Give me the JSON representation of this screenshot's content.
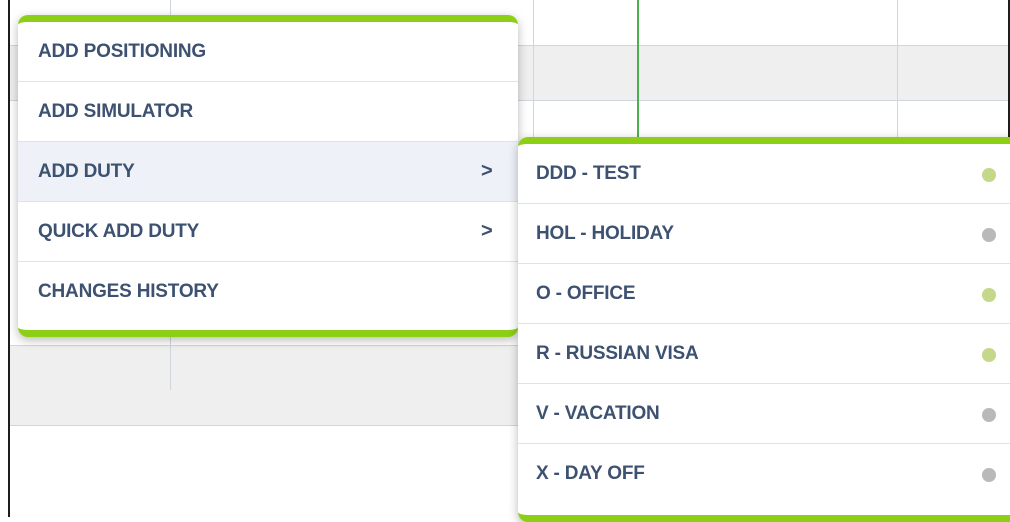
{
  "main_menu": {
    "items": [
      {
        "label": "ADD POSITIONING",
        "has_submenu": false
      },
      {
        "label": "ADD SIMULATOR",
        "has_submenu": false
      },
      {
        "label": "ADD DUTY",
        "has_submenu": true,
        "chevron": ">"
      },
      {
        "label": "QUICK ADD DUTY",
        "has_submenu": true,
        "chevron": ">"
      },
      {
        "label": "CHANGES HISTORY",
        "has_submenu": false
      }
    ]
  },
  "duty_submenu": {
    "items": [
      {
        "label": "DDD - TEST",
        "dot_color": "#c5d88a"
      },
      {
        "label": "HOL - HOLIDAY",
        "dot_color": "#b9b9b9"
      },
      {
        "label": "O - OFFICE",
        "dot_color": "#c5d88a"
      },
      {
        "label": "R - RUSSIAN VISA",
        "dot_color": "#c5d88a"
      },
      {
        "label": "V - VACATION",
        "dot_color": "#b9b9b9"
      },
      {
        "label": "X - DAY OFF",
        "dot_color": "#b9b9b9"
      }
    ]
  },
  "colors": {
    "accent_green": "#8ccf16",
    "text": "#3d5170",
    "active_bg": "#eef1f7",
    "timeline_line": "#4caf50"
  }
}
